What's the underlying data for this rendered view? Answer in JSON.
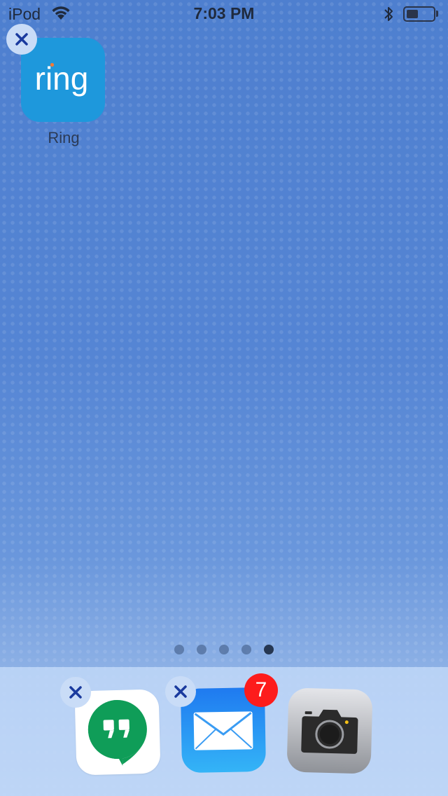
{
  "status_bar": {
    "carrier": "iPod",
    "time": "7:03 PM",
    "battery_level": 0.45
  },
  "home": {
    "apps": [
      {
        "name": "Ring",
        "icon_text": "ring",
        "icon_color": "#1e98dc"
      }
    ],
    "page_count": 5,
    "current_page": 5
  },
  "dock": {
    "apps": [
      {
        "app": "Hangouts",
        "icon": "hangouts-icon",
        "brand_color": "#0f9d58"
      },
      {
        "app": "Mail",
        "icon": "mail-icon",
        "badge": "7"
      },
      {
        "app": "Camera",
        "icon": "camera-icon"
      }
    ]
  },
  "colors": {
    "delete_x": "#1a3a9e",
    "badge_red": "#fd1c1c",
    "ring_dot": "#f37a35"
  }
}
